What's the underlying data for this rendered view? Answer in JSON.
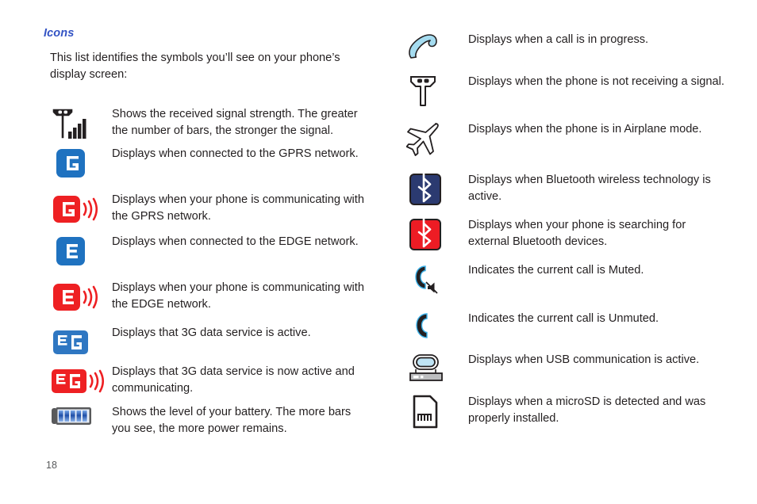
{
  "document": {
    "section_heading": "Icons",
    "intro_text": "This list identifies the symbols you’ll see on your phone’s display screen:",
    "page_number": "18",
    "colors": {
      "heading_blue": "#3353c4",
      "body_text": "#231f20",
      "icon_blue": "#1f72c0",
      "icon_red": "#ee2023",
      "bluetooth_navy": "#2b3a70",
      "bluetooth_red": "#ed1c24",
      "handset_light_blue": "#a5dcf0",
      "battery_blue": "#2b5fb8",
      "page_number_gray": "#58595b"
    }
  },
  "left_column": {
    "items": [
      {
        "icon": "signal-strength-icon",
        "description": "Shows the received signal strength. The greater the number of bars, the stronger the signal."
      },
      {
        "icon": "gprs-connected-icon",
        "description": "Displays when connected to the GPRS network."
      },
      {
        "icon": "gprs-communicating-icon",
        "description": "Displays when your phone is communicating with the GPRS network."
      },
      {
        "icon": "edge-connected-icon",
        "description": "Displays when connected to the EDGE network."
      },
      {
        "icon": "edge-communicating-icon",
        "description": "Displays when your phone is communicating with the EDGE network."
      },
      {
        "icon": "three-g-active-icon",
        "description": "Displays that 3G data service is active."
      },
      {
        "icon": "three-g-communicating-icon",
        "description": "Displays that 3G data service is now active and communicating."
      },
      {
        "icon": "battery-level-icon",
        "description": "Shows the level of your battery. The more bars you see, the more power remains."
      }
    ]
  },
  "right_column": {
    "items": [
      {
        "icon": "call-in-progress-icon",
        "description": "Displays when a call is in progress."
      },
      {
        "icon": "no-signal-icon",
        "description": "Displays when the phone is not receiving a signal."
      },
      {
        "icon": "airplane-mode-icon",
        "description": "Displays when the phone is in Airplane mode."
      },
      {
        "icon": "bluetooth-active-icon",
        "description": "Displays when Bluetooth wireless technology is active."
      },
      {
        "icon": "bluetooth-searching-icon",
        "description": "Displays when your phone is searching for external Bluetooth devices."
      },
      {
        "icon": "call-muted-icon",
        "description": "Indicates the current call is Muted."
      },
      {
        "icon": "call-unmuted-icon",
        "description": "Indicates the current call is Unmuted."
      },
      {
        "icon": "usb-active-icon",
        "description": "Displays when USB communication is active."
      },
      {
        "icon": "microsd-detected-icon",
        "description": "Displays when a microSD is detected and was properly installed."
      }
    ]
  },
  "icon_labels": {
    "gprs": "G",
    "edge": "E",
    "three_g": "3G"
  }
}
